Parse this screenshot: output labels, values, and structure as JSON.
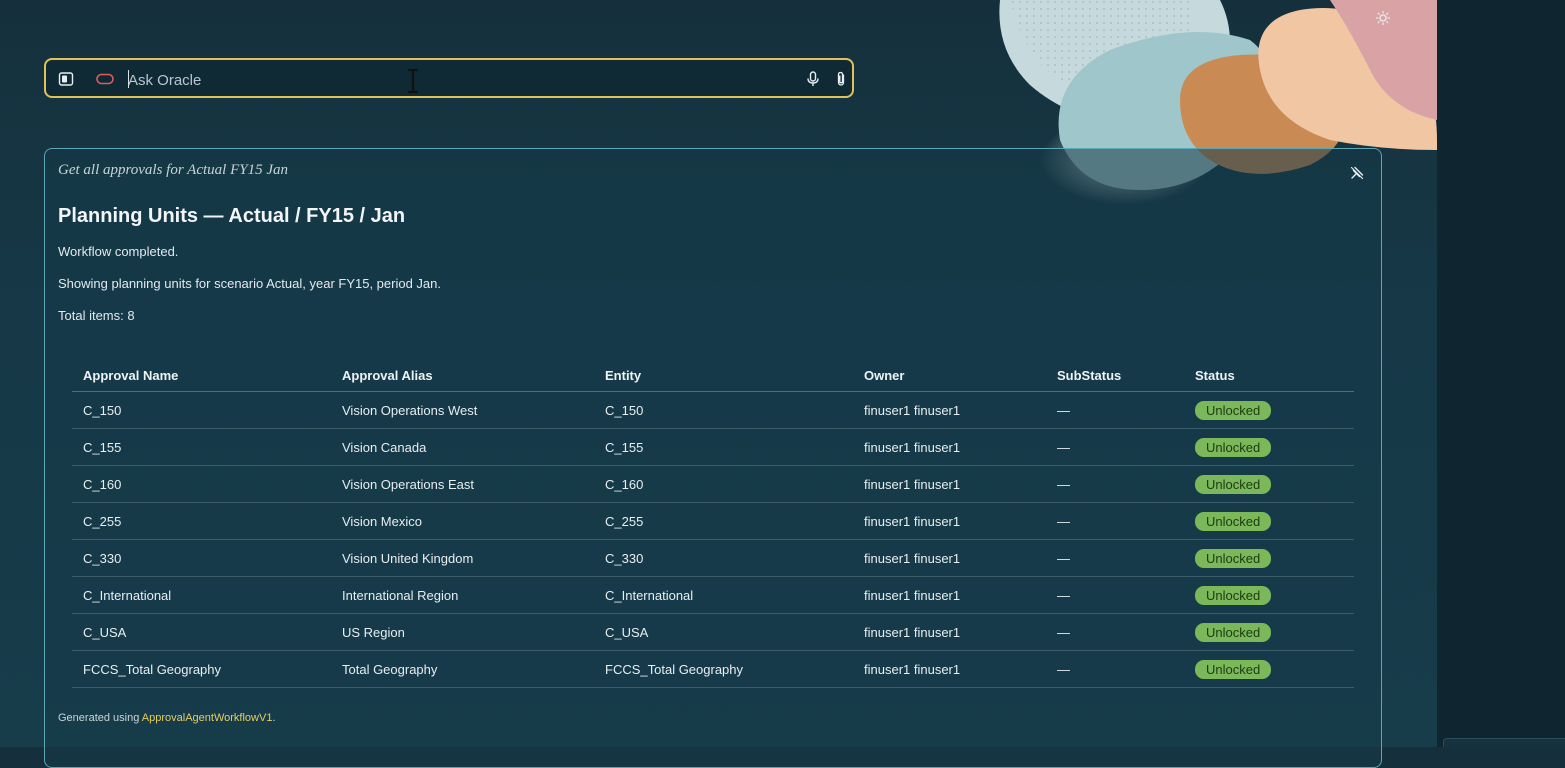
{
  "ask": {
    "placeholder": "Ask Oracle"
  },
  "result": {
    "query": "Get all approvals for Actual FY15 Jan",
    "title": "Planning Units — Actual / FY15 / Jan",
    "status_line": "Workflow completed.",
    "description": "Showing planning units for scenario Actual, year FY15, period Jan.",
    "total": "Total items: 8",
    "columns": [
      "Approval Name",
      "Approval Alias",
      "Entity",
      "Owner",
      "SubStatus",
      "Status"
    ],
    "rows": [
      [
        "C_150",
        "Vision Operations West",
        "C_150",
        "finuser1 finuser1",
        "—",
        "Unlocked"
      ],
      [
        "C_155",
        "Vision Canada",
        "C_155",
        "finuser1 finuser1",
        "—",
        "Unlocked"
      ],
      [
        "C_160",
        "Vision Operations East",
        "C_160",
        "finuser1 finuser1",
        "—",
        "Unlocked"
      ],
      [
        "C_255",
        "Vision Mexico",
        "C_255",
        "finuser1 finuser1",
        "—",
        "Unlocked"
      ],
      [
        "C_330",
        "Vision United Kingdom",
        "C_330",
        "finuser1 finuser1",
        "—",
        "Unlocked"
      ],
      [
        "C_International",
        "International Region",
        "C_International",
        "finuser1 finuser1",
        "—",
        "Unlocked"
      ],
      [
        "C_USA",
        "US Region",
        "C_USA",
        "finuser1 finuser1",
        "—",
        "Unlocked"
      ],
      [
        "FCCS_Total Geography",
        "Total Geography",
        "FCCS_Total Geography",
        "finuser1 finuser1",
        "—",
        "Unlocked"
      ]
    ],
    "footer_prefix": "Generated using ",
    "footer_link": "ApprovalAgentWorkflowV1",
    "footer_suffix": "."
  },
  "icons": {
    "theme": "sun-icon",
    "sidebar": "sidebar-toggle-icon",
    "mode": "pill-icon",
    "mic": "microphone-icon",
    "attach": "paperclip-icon",
    "unpin": "unpin-icon"
  },
  "colors": {
    "accent_border": "#e0c25a",
    "panel_border": "#5aa7b6",
    "status_unlocked": "#7bb85a",
    "link": "#e4cf67"
  }
}
